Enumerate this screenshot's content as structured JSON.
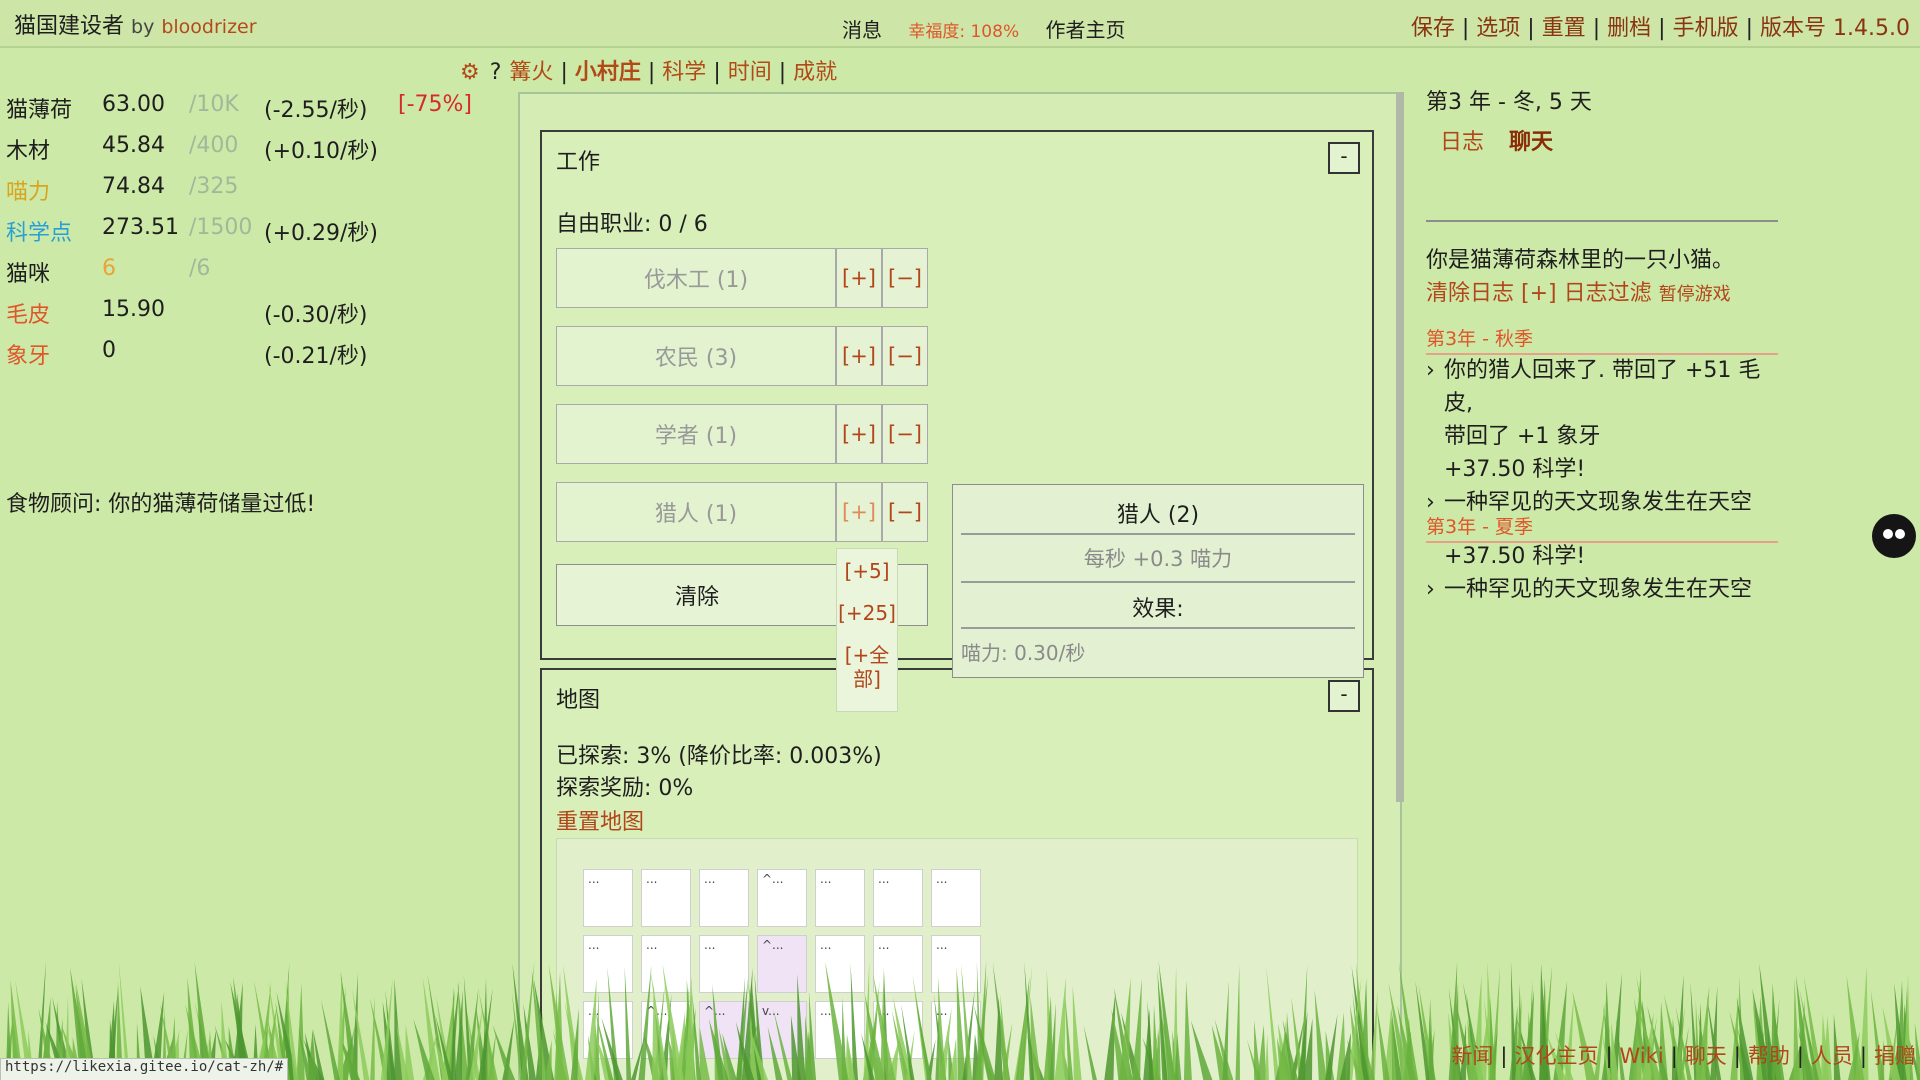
{
  "header": {
    "title": "猫国建设者",
    "by": "by",
    "author": "bloodrizer",
    "messages": "消息",
    "happiness": "幸福度: 108%",
    "author_home": "作者主页",
    "nav": [
      "保存",
      "选项",
      "重置",
      "删档",
      "手机版",
      "版本号 1.4.5.0"
    ]
  },
  "tabs": {
    "gear": "⚙",
    "help": "?",
    "items": [
      "篝火",
      "小村庄",
      "科学",
      "时间",
      "成就"
    ],
    "active_index": 1
  },
  "resources": [
    {
      "name": "猫薄荷",
      "value": "63.00",
      "max": "/10K",
      "rate": "(-2.55/秒)",
      "extra": "[-75%]",
      "color": "#1e1e1e"
    },
    {
      "name": "木材",
      "value": "45.84",
      "max": "/400",
      "rate": "(+0.10/秒)",
      "extra": "",
      "color": "#1e1e1e"
    },
    {
      "name": "喵力",
      "value": "74.84",
      "max": "/325",
      "rate": "",
      "extra": "",
      "color": "#d9a51e"
    },
    {
      "name": "科学点",
      "value": "273.51",
      "max": "/1500",
      "rate": "(+0.29/秒)",
      "extra": "",
      "color": "#2a9fd6"
    },
    {
      "name": "猫咪",
      "value": "6",
      "max": "/6",
      "rate": "",
      "extra": "",
      "color": "#1e1e1e",
      "value_color": "#e8a43a"
    },
    {
      "name": "毛皮",
      "value": "15.90",
      "max": "",
      "rate": "(-0.30/秒)",
      "extra": "",
      "color": "#e0552a"
    },
    {
      "name": "象牙",
      "value": "0",
      "max": "",
      "rate": "(-0.21/秒)",
      "extra": "",
      "color": "#e0552a"
    }
  ],
  "food_advisor": "食物顾问: 你的猫薄荷储量过低!",
  "work": {
    "title": "工作",
    "toggle": "-",
    "free_jobs": "自由职业: 0 / 6",
    "jobs": [
      "伐木工 (1)",
      "农民 (3)",
      "学者 (1)",
      "猎人 (1)"
    ],
    "plus": "[+]",
    "minus": "[−]",
    "clear": "清除",
    "plus_menu": [
      "[+5]",
      "[+25]",
      "[+全",
      "部]"
    ]
  },
  "tooltip": {
    "title": "猎人 (2)",
    "desc": "每秒 +0.3 喵力",
    "effects": "效果:",
    "line": "喵力: 0.30/秒"
  },
  "map": {
    "title": "地图",
    "toggle": "-",
    "explored": "已探索: 3% (降价比率: 0.003%)",
    "bonus": "探索奖励: 0%",
    "reset": "重置地图",
    "rows": [
      [
        {
          "t": "...",
          "p": false
        },
        {
          "t": "...",
          "p": false
        },
        {
          "t": "...",
          "p": false
        },
        {
          "t": "^...",
          "p": false
        },
        {
          "t": "...",
          "p": false
        },
        {
          "t": "...",
          "p": false
        },
        {
          "t": "...",
          "p": false
        }
      ],
      [
        {
          "t": "...",
          "p": false
        },
        {
          "t": "...",
          "p": false
        },
        {
          "t": "...",
          "p": false
        },
        {
          "t": "^...",
          "p": true
        },
        {
          "t": "...",
          "p": false
        },
        {
          "t": "...",
          "p": false
        },
        {
          "t": "...",
          "p": false
        }
      ],
      [
        {
          "t": "...",
          "p": false
        },
        {
          "t": "^...",
          "p": false
        },
        {
          "t": "^...",
          "p": true
        },
        {
          "t": "v...",
          "p": true
        },
        {
          "t": "...",
          "p": false
        },
        {
          "t": "...",
          "p": false
        },
        {
          "t": "...",
          "p": false
        }
      ]
    ]
  },
  "right": {
    "date": "第3 年 - 冬, 5 天",
    "log_tab": "日志",
    "chat_tab": "聊天",
    "intro": "你是猫薄荷森林里的一只小猫。",
    "clear_log": "清除日志",
    "filter_plus": "[+]",
    "filter": "日志过滤",
    "pause": "暂停游戏",
    "seasons": [
      {
        "title": "第3年 - 秋季",
        "entries": [
          {
            "bullet": "›",
            "text": "你的猎人回来了. 带回了 +51 毛皮,"
          },
          {
            "bullet": "",
            "text": "带回了 +1 象牙"
          },
          {
            "bullet": "",
            "text": "+37.50 科学!"
          },
          {
            "bullet": "›",
            "text": "一种罕见的天文现象发生在天空"
          }
        ]
      },
      {
        "title": "第3年 - 夏季",
        "entries": [
          {
            "bullet": "",
            "text": "+37.50 科学!"
          },
          {
            "bullet": "›",
            "text": "一种罕见的天文现象发生在天空"
          }
        ]
      }
    ]
  },
  "footer": [
    "新闻",
    "汉化主页",
    "Wiki",
    "聊天",
    "帮助",
    "人员",
    "捐赠"
  ],
  "status_url": "https://likexia.gitee.io/cat-zh/#"
}
